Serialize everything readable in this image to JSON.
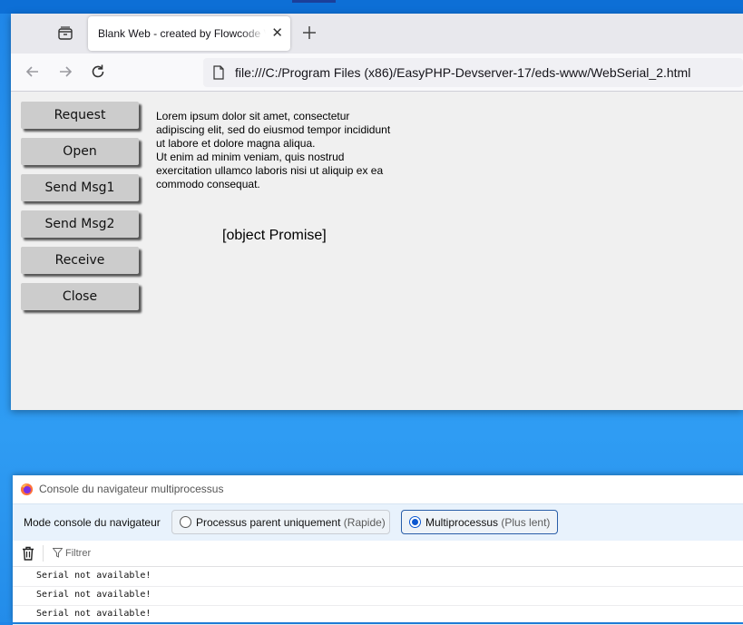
{
  "browser": {
    "tab_title": "Blank Web - created by Flowcode V",
    "tab_close": "✕",
    "new_tab": "+",
    "url": "file:///C:/Program Files (x86)/EasyPHP-Devserver-17/eds-www/WebSerial_2.html"
  },
  "page": {
    "buttons": [
      "Request",
      "Open",
      "Send Msg1",
      "Send Msg2",
      "Receive",
      "Close"
    ],
    "lorem_lines": [
      "Lorem ipsum dolor sit amet, consectetur",
      "adipiscing elit, sed do eiusmod tempor incididunt",
      "ut labore et dolore magna aliqua.",
      "Ut enim ad minim veniam, quis nostrud",
      "exercitation ullamco laboris nisi ut aliquip ex ea",
      "commodo consequat."
    ],
    "status": "[object Promise]"
  },
  "console": {
    "title": "Console du navigateur multiprocessus",
    "mode_label": "Mode console du navigateur",
    "option_parent": "Processus parent uniquement",
    "option_parent_hint": "(Rapide)",
    "option_multi": "Multiprocessus",
    "option_multi_hint": "(Plus lent)",
    "selected": "multi",
    "filter_placeholder": "Filtrer",
    "messages": [
      "Serial not available!",
      "Serial not available!",
      "Serial not available!"
    ]
  },
  "colors": {
    "desktop": "#2a96f0",
    "accent": "#0b57d0",
    "button_bg": "#cccccc"
  },
  "icons": [
    "tab-list-icon",
    "close-icon",
    "plus-icon",
    "back-arrow-icon",
    "forward-arrow-icon",
    "reload-icon",
    "page-icon",
    "firefox-logo-icon",
    "trash-icon",
    "filter-icon"
  ]
}
